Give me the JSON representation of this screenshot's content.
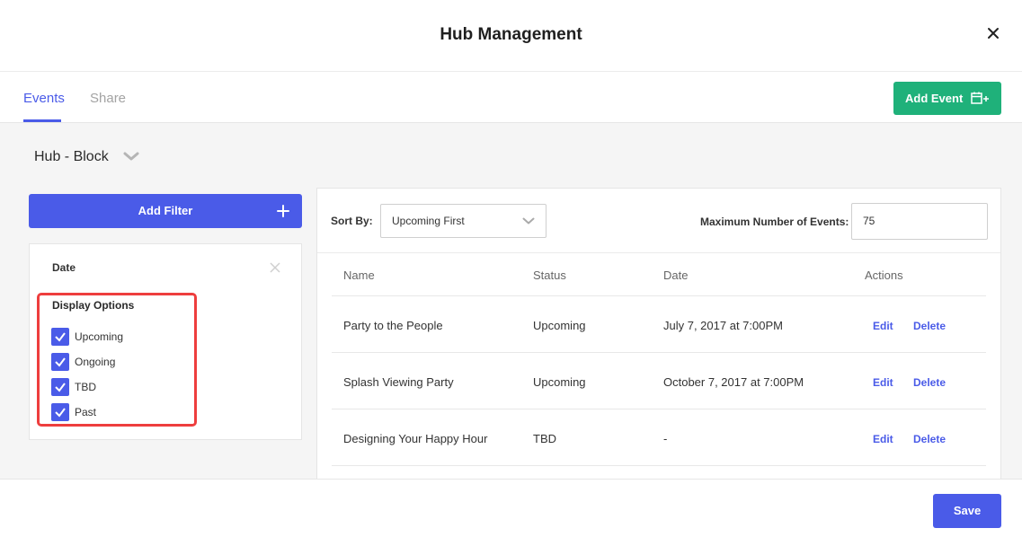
{
  "modal": {
    "title": "Hub Management",
    "close_icon": "close-icon"
  },
  "tabs": [
    {
      "label": "Events",
      "active": true
    },
    {
      "label": "Share",
      "active": false
    }
  ],
  "add_event": {
    "label": "Add Event",
    "icon": "calendar-plus-icon",
    "color": "#1fb17a"
  },
  "hub": {
    "name": "Hub - Block",
    "icon": "chevron-down-icon"
  },
  "filters": {
    "add_label": "Add Filter",
    "card": {
      "label": "Date",
      "display_options_label": "Display Options",
      "options": [
        {
          "label": "Upcoming",
          "checked": true
        },
        {
          "label": "Ongoing",
          "checked": true
        },
        {
          "label": "TBD",
          "checked": true
        },
        {
          "label": "Past",
          "checked": true
        }
      ]
    }
  },
  "events": {
    "sort_label": "Sort By:",
    "sort_value": "Upcoming First",
    "max_label": "Maximum Number of Events:",
    "max_value": "75",
    "columns": [
      "Name",
      "Status",
      "Date",
      "Actions"
    ],
    "rows": [
      {
        "name": "Party to the People",
        "status": "Upcoming",
        "date": "July 7, 2017 at 7:00PM",
        "edit": "Edit",
        "delete": "Delete"
      },
      {
        "name": "Splash Viewing Party",
        "status": "Upcoming",
        "date": "October 7, 2017 at 7:00PM",
        "edit": "Edit",
        "delete": "Delete"
      },
      {
        "name": "Designing Your Happy Hour",
        "status": "TBD",
        "date": "-",
        "edit": "Edit",
        "delete": "Delete"
      }
    ]
  },
  "footer": {
    "save_label": "Save"
  },
  "colors": {
    "accent": "#4a5be8",
    "success": "#1fb17a",
    "highlight": "#ee3e3e"
  }
}
